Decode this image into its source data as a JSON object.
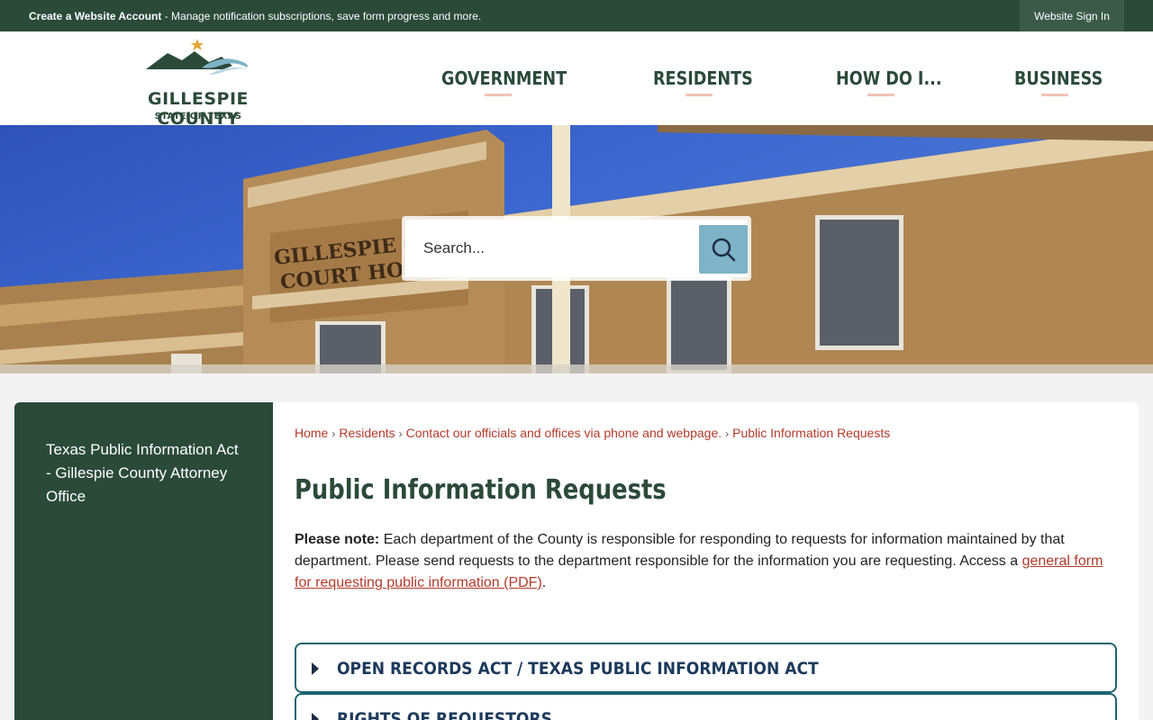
{
  "topbar": {
    "create_account": "Create a Website Account",
    "create_account_desc": " - Manage notification subscriptions, save form progress and more.",
    "sign_in": "Website Sign In"
  },
  "logo": {
    "name": "GILLESPIE COUNTY",
    "subtitle": "STATE OF TEXAS"
  },
  "nav": {
    "items": [
      {
        "label": "GOVERNMENT"
      },
      {
        "label": "RESIDENTS"
      },
      {
        "label": "HOW DO I..."
      },
      {
        "label": "BUSINESS"
      }
    ]
  },
  "hero": {
    "building_sign_line1": "GILLESPIE COUNT",
    "building_sign_line2": "COURT HOUSE"
  },
  "search": {
    "placeholder": "Search..."
  },
  "sidebar": {
    "items": [
      {
        "label": "Texas Public Information Act - Gillespie County Attorney Office"
      }
    ]
  },
  "breadcrumb": {
    "items": [
      {
        "label": "Home"
      },
      {
        "label": "Residents"
      },
      {
        "label": "Contact our officials and offices via phone and webpage."
      },
      {
        "label": "Public Information Requests"
      }
    ]
  },
  "main": {
    "title": "Public Information Requests",
    "note_label": "Please note:",
    "note_text": " Each department of the County is responsible for responding to requests for information maintained by that department. Please send requests to the department responsible for the information you are requesting. Access a ",
    "note_link": "general form for requesting public information (PDF)",
    "note_end": "."
  },
  "accordions": [
    {
      "label": "OPEN RECORDS ACT / TEXAS PUBLIC INFORMATION ACT"
    },
    {
      "label": "RIGHTS OF REQUESTORS"
    }
  ],
  "colors": {
    "brand_green": "#2b4a3a",
    "link_red": "#b23a2b",
    "search_button": "#7fb3c7",
    "nav_underline": "#f2c3b6",
    "accordion_border": "#1e6470"
  }
}
